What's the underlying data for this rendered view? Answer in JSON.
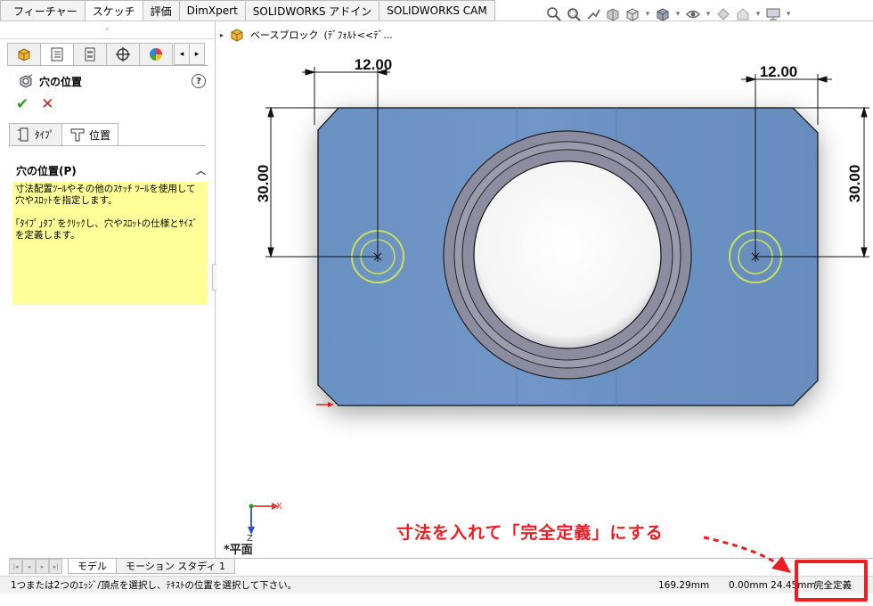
{
  "command_tabs": [
    {
      "label": "フィーチャー",
      "active": false
    },
    {
      "label": "スケッチ",
      "active": true
    },
    {
      "label": "評価",
      "active": false
    },
    {
      "label": "DimXpert",
      "active": false
    },
    {
      "label": "SOLIDWORKS アドイン",
      "active": false
    },
    {
      "label": "SOLIDWORKS CAM",
      "active": false
    }
  ],
  "view_toolbar": {
    "icons": [
      "zoom-to-fit-icon",
      "zoom-to-area-icon",
      "previous-view-icon",
      "section-view-icon",
      "view-orientation-icon",
      "display-style-icon",
      "hide-show-items-icon",
      "edit-appearance-icon",
      "apply-scene-icon",
      "view-settings-icon"
    ]
  },
  "property_manager": {
    "tabs": [
      "feature-manager-icon",
      "property-manager-icon",
      "configuration-manager-icon",
      "dimxpert-manager-icon",
      "display-manager-icon"
    ],
    "scroll_left": "◂",
    "scroll_right": "▸",
    "title": "穴の位置",
    "help": "?",
    "ok_symbol": "✔",
    "cancel_symbol": "✕",
    "sub_tabs": [
      {
        "label": "ﾀｲﾌﾟ",
        "active": false
      },
      {
        "label": "位置",
        "active": true
      }
    ],
    "group_title": "穴の位置(P)",
    "collapse_symbol": "︿",
    "message": "寸法配置ﾂｰﾙやその他のｽｹｯﾁ ﾂｰﾙを使用して穴やｽﾛｯﾄを指定します。\n\n｢ﾀｲﾌﾟ｣ﾀﾌﾞをｸﾘｯｸし、穴やｽﾛｯﾄの仕様とｻｲｽﾞを定義します。"
  },
  "feature_tree": {
    "expand": "▸",
    "label": "ベースブロック",
    "config": "(ﾃﾞﾌｫﾙﾄ<<ﾃﾞ..."
  },
  "dimensions": {
    "left_horizontal": "12.00",
    "right_horizontal": "12.00",
    "left_vertical": "30.00",
    "right_vertical": "30.00"
  },
  "triad": {
    "x": "X",
    "z": "Z",
    "plane": "*平面"
  },
  "bottom_tabs": [
    {
      "label": "モデル",
      "active": true
    },
    {
      "label": "モーション スタディ 1",
      "active": false
    }
  ],
  "status_bar": {
    "message": "1つまたは2つのｴｯｼﾞ/頂点を選択し、ﾃｷｽﾄの位置を選択して下さい。",
    "value1": "169.29mm",
    "value2": "0.00mm 24.45mm",
    "state": "完全定義"
  },
  "annotation": {
    "text": "寸法を入れて「完全定義」にする",
    "color": "#ee1d23"
  },
  "colors": {
    "part_face": "#6d94c5",
    "boss_ring": "#8a8a9e",
    "hole_highlight": "#c8e15a"
  }
}
